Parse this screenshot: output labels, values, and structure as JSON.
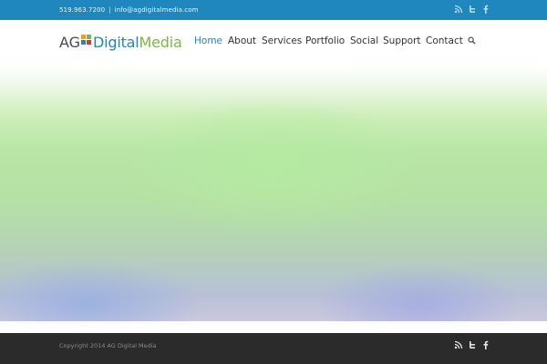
{
  "topbar": {
    "phone": "519.963.7200",
    "separator": "|",
    "email": "info@agdigitalmedia.com",
    "social": [
      {
        "icon": "rss-icon"
      },
      {
        "icon": "twitter-icon"
      },
      {
        "icon": "facebook-icon"
      }
    ]
  },
  "logo": {
    "prefix": "AG",
    "word_part_1": "Digital",
    "word_part_2": "Media"
  },
  "nav": {
    "items": [
      {
        "label": "Home",
        "active": true
      },
      {
        "label": "About"
      },
      {
        "label": "Services"
      },
      {
        "label": "Portfolio"
      },
      {
        "label": "Social"
      },
      {
        "label": "Support"
      },
      {
        "label": "Contact"
      }
    ],
    "search_icon": "search-icon"
  },
  "footer": {
    "copyright": "Copyright 2014 AG Digital Media",
    "social": [
      {
        "icon": "rss-icon"
      },
      {
        "icon": "twitter-icon"
      },
      {
        "icon": "facebook-icon"
      }
    ]
  },
  "colors": {
    "topbar_bg": "#1f87be",
    "accent_blue": "#1f87be",
    "accent_green": "#7ab648",
    "nav_text": "#333333",
    "footer_bg": "#2b2b2b",
    "footer_text": "#8a8a8a"
  }
}
